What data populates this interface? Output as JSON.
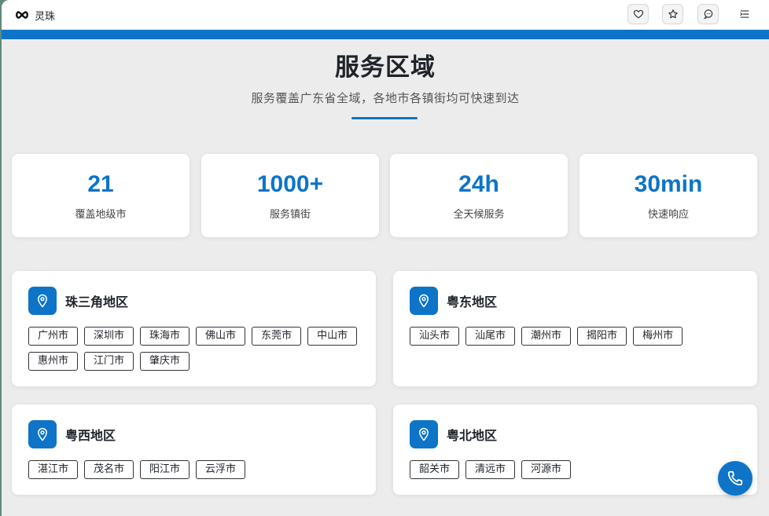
{
  "app": {
    "name": "灵珠"
  },
  "toolbar": {
    "favorite_icon": "heart-icon",
    "star_icon": "star-icon",
    "chat_icon": "chat-icon",
    "menu_icon": "menu-icon"
  },
  "colors": {
    "accent": "#0d74c7",
    "background": "#ececec",
    "card": "#ffffff"
  },
  "header": {
    "title": "服务区域",
    "subtitle": "服务覆盖广东省全域，各地市各镇街均可快速到达"
  },
  "stats": [
    {
      "value": "21",
      "label": "覆盖地级市"
    },
    {
      "value": "1000+",
      "label": "服务镇街"
    },
    {
      "value": "24h",
      "label": "全天候服务"
    },
    {
      "value": "30min",
      "label": "快速响应"
    }
  ],
  "regions": [
    {
      "name": "珠三角地区",
      "cities": [
        "广州市",
        "深圳市",
        "珠海市",
        "佛山市",
        "东莞市",
        "中山市",
        "惠州市",
        "江门市",
        "肇庆市"
      ]
    },
    {
      "name": "粤东地区",
      "cities": [
        "汕头市",
        "汕尾市",
        "潮州市",
        "揭阳市",
        "梅州市"
      ]
    },
    {
      "name": "粤西地区",
      "cities": [
        "湛江市",
        "茂名市",
        "阳江市",
        "云浮市"
      ]
    },
    {
      "name": "粤北地区",
      "cities": [
        "韶关市",
        "清远市",
        "河源市"
      ]
    }
  ],
  "call_icon": "phone-icon"
}
